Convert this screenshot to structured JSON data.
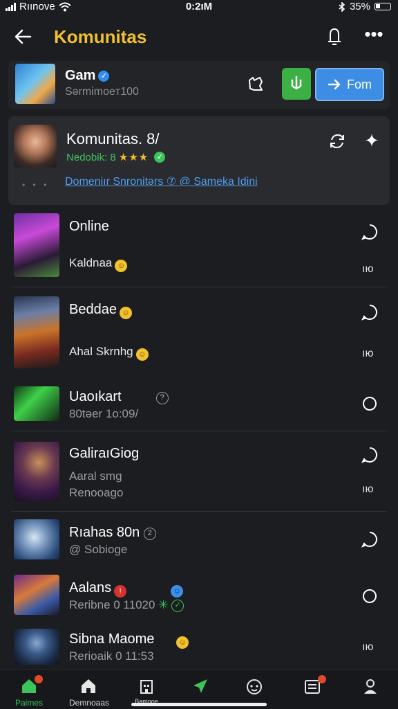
{
  "status_bar": {
    "carrier": "Rıınove",
    "time": "0:2ıM",
    "battery": "35%"
  },
  "header": {
    "title": "Komunitas"
  },
  "game_row": {
    "name": "Gam",
    "subtitle": "Sərmimoeт100",
    "follow_label": "Fom"
  },
  "community": {
    "name": "Komunitas. 8/",
    "rating_prefix": "Nedobik: 8",
    "rating_stars": "★★★",
    "links": "Domeniır Snronitərs ⑦ @ Sameka Idini"
  },
  "items": [
    {
      "title": "Online",
      "subtitle": "Kaldnaa",
      "count": "ıю"
    },
    {
      "title": "Beddae",
      "subtitle": "Ahal Skrnhg",
      "count": "ıю"
    },
    {
      "title": "Uaoıkart",
      "subtitle": "80təer 1o:09/",
      "count": ""
    },
    {
      "title": "GaliraıGiog",
      "subtitle": "Aaral smg",
      "subtitle2": "Renooago",
      "count": "ıю"
    },
    {
      "title": "Rıahas 80n",
      "subtitle": "@ Sobioge",
      "count": ""
    },
    {
      "title": "Aalans",
      "subtitle": "Reribne 0 11020",
      "count": ""
    },
    {
      "title": "Sibna Maome",
      "subtitle": "Rerioaik 0 11:53",
      "count": "ıю"
    }
  ],
  "bottom_nav": [
    {
      "label": "Paimes"
    },
    {
      "label": "Demnoaas"
    },
    {
      "label": "Bamnoe"
    },
    {
      "label": ""
    },
    {
      "label": ""
    },
    {
      "label": ""
    },
    {
      "label": ""
    }
  ],
  "colors": {
    "accent_title": "#f2c12e",
    "follow_button": "#3d8de4",
    "green": "#3caf45",
    "link": "#4f9ef0"
  }
}
